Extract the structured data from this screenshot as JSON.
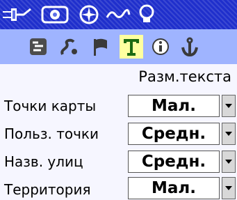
{
  "top_icons": [
    {
      "name": "plug-icon"
    },
    {
      "name": "device-icon"
    },
    {
      "name": "compass-icon"
    },
    {
      "name": "wave-icon"
    },
    {
      "name": "lightbulb-icon"
    }
  ],
  "tabs": [
    {
      "name": "tab-map-settings",
      "selected": false
    },
    {
      "name": "tab-routing",
      "selected": false
    },
    {
      "name": "tab-flag",
      "selected": false
    },
    {
      "name": "tab-text",
      "selected": true
    },
    {
      "name": "tab-info",
      "selected": false
    },
    {
      "name": "tab-marine",
      "selected": false
    }
  ],
  "text_size_header": "Разм.текста",
  "rows": [
    {
      "label": "Точки карты",
      "value": "Мал."
    },
    {
      "label": "Польз. точки",
      "value": "Средн."
    },
    {
      "label": "Назв. улиц",
      "value": "Средн."
    },
    {
      "label": "Территория",
      "value": "Мал."
    }
  ],
  "colors": {
    "title_bar": "#1f2fcc",
    "tab_bar": "#9fb4ff",
    "selected_tab": "#ffffa0"
  }
}
